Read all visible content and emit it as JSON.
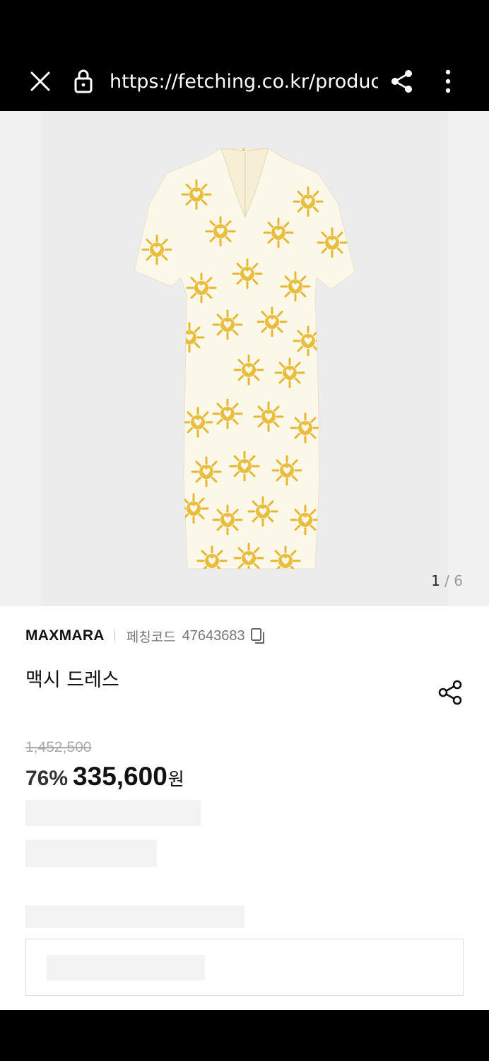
{
  "browser": {
    "url": "https://fetching.co.kr/produc",
    "icons": [
      "close-icon",
      "lock-icon",
      "share-icon",
      "more-vert-icon"
    ]
  },
  "gallery": {
    "current": "1",
    "separator": "/",
    "total": "6",
    "accent": "#e6b832"
  },
  "product": {
    "brand": "MAXMARA",
    "code_label": "페칭코드",
    "code": "47643683",
    "title": "맥시 드레스",
    "original_price": "1,452,500",
    "discount": "76%",
    "price": "335,600",
    "currency": "원"
  }
}
